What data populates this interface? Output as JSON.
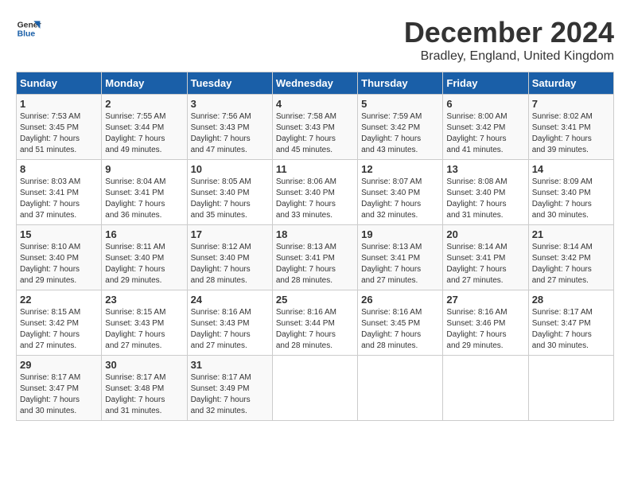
{
  "logo": {
    "line1": "General",
    "line2": "Blue"
  },
  "title": "December 2024",
  "location": "Bradley, England, United Kingdom",
  "headers": [
    "Sunday",
    "Monday",
    "Tuesday",
    "Wednesday",
    "Thursday",
    "Friday",
    "Saturday"
  ],
  "weeks": [
    [
      {
        "day": "1",
        "info": "Sunrise: 7:53 AM\nSunset: 3:45 PM\nDaylight: 7 hours\nand 51 minutes."
      },
      {
        "day": "2",
        "info": "Sunrise: 7:55 AM\nSunset: 3:44 PM\nDaylight: 7 hours\nand 49 minutes."
      },
      {
        "day": "3",
        "info": "Sunrise: 7:56 AM\nSunset: 3:43 PM\nDaylight: 7 hours\nand 47 minutes."
      },
      {
        "day": "4",
        "info": "Sunrise: 7:58 AM\nSunset: 3:43 PM\nDaylight: 7 hours\nand 45 minutes."
      },
      {
        "day": "5",
        "info": "Sunrise: 7:59 AM\nSunset: 3:42 PM\nDaylight: 7 hours\nand 43 minutes."
      },
      {
        "day": "6",
        "info": "Sunrise: 8:00 AM\nSunset: 3:42 PM\nDaylight: 7 hours\nand 41 minutes."
      },
      {
        "day": "7",
        "info": "Sunrise: 8:02 AM\nSunset: 3:41 PM\nDaylight: 7 hours\nand 39 minutes."
      }
    ],
    [
      {
        "day": "8",
        "info": "Sunrise: 8:03 AM\nSunset: 3:41 PM\nDaylight: 7 hours\nand 37 minutes."
      },
      {
        "day": "9",
        "info": "Sunrise: 8:04 AM\nSunset: 3:41 PM\nDaylight: 7 hours\nand 36 minutes."
      },
      {
        "day": "10",
        "info": "Sunrise: 8:05 AM\nSunset: 3:40 PM\nDaylight: 7 hours\nand 35 minutes."
      },
      {
        "day": "11",
        "info": "Sunrise: 8:06 AM\nSunset: 3:40 PM\nDaylight: 7 hours\nand 33 minutes."
      },
      {
        "day": "12",
        "info": "Sunrise: 8:07 AM\nSunset: 3:40 PM\nDaylight: 7 hours\nand 32 minutes."
      },
      {
        "day": "13",
        "info": "Sunrise: 8:08 AM\nSunset: 3:40 PM\nDaylight: 7 hours\nand 31 minutes."
      },
      {
        "day": "14",
        "info": "Sunrise: 8:09 AM\nSunset: 3:40 PM\nDaylight: 7 hours\nand 30 minutes."
      }
    ],
    [
      {
        "day": "15",
        "info": "Sunrise: 8:10 AM\nSunset: 3:40 PM\nDaylight: 7 hours\nand 29 minutes."
      },
      {
        "day": "16",
        "info": "Sunrise: 8:11 AM\nSunset: 3:40 PM\nDaylight: 7 hours\nand 29 minutes."
      },
      {
        "day": "17",
        "info": "Sunrise: 8:12 AM\nSunset: 3:40 PM\nDaylight: 7 hours\nand 28 minutes."
      },
      {
        "day": "18",
        "info": "Sunrise: 8:13 AM\nSunset: 3:41 PM\nDaylight: 7 hours\nand 28 minutes."
      },
      {
        "day": "19",
        "info": "Sunrise: 8:13 AM\nSunset: 3:41 PM\nDaylight: 7 hours\nand 27 minutes."
      },
      {
        "day": "20",
        "info": "Sunrise: 8:14 AM\nSunset: 3:41 PM\nDaylight: 7 hours\nand 27 minutes."
      },
      {
        "day": "21",
        "info": "Sunrise: 8:14 AM\nSunset: 3:42 PM\nDaylight: 7 hours\nand 27 minutes."
      }
    ],
    [
      {
        "day": "22",
        "info": "Sunrise: 8:15 AM\nSunset: 3:42 PM\nDaylight: 7 hours\nand 27 minutes."
      },
      {
        "day": "23",
        "info": "Sunrise: 8:15 AM\nSunset: 3:43 PM\nDaylight: 7 hours\nand 27 minutes."
      },
      {
        "day": "24",
        "info": "Sunrise: 8:16 AM\nSunset: 3:43 PM\nDaylight: 7 hours\nand 27 minutes."
      },
      {
        "day": "25",
        "info": "Sunrise: 8:16 AM\nSunset: 3:44 PM\nDaylight: 7 hours\nand 28 minutes."
      },
      {
        "day": "26",
        "info": "Sunrise: 8:16 AM\nSunset: 3:45 PM\nDaylight: 7 hours\nand 28 minutes."
      },
      {
        "day": "27",
        "info": "Sunrise: 8:16 AM\nSunset: 3:46 PM\nDaylight: 7 hours\nand 29 minutes."
      },
      {
        "day": "28",
        "info": "Sunrise: 8:17 AM\nSunset: 3:47 PM\nDaylight: 7 hours\nand 30 minutes."
      }
    ],
    [
      {
        "day": "29",
        "info": "Sunrise: 8:17 AM\nSunset: 3:47 PM\nDaylight: 7 hours\nand 30 minutes."
      },
      {
        "day": "30",
        "info": "Sunrise: 8:17 AM\nSunset: 3:48 PM\nDaylight: 7 hours\nand 31 minutes."
      },
      {
        "day": "31",
        "info": "Sunrise: 8:17 AM\nSunset: 3:49 PM\nDaylight: 7 hours\nand 32 minutes."
      },
      {
        "day": "",
        "info": ""
      },
      {
        "day": "",
        "info": ""
      },
      {
        "day": "",
        "info": ""
      },
      {
        "day": "",
        "info": ""
      }
    ]
  ]
}
